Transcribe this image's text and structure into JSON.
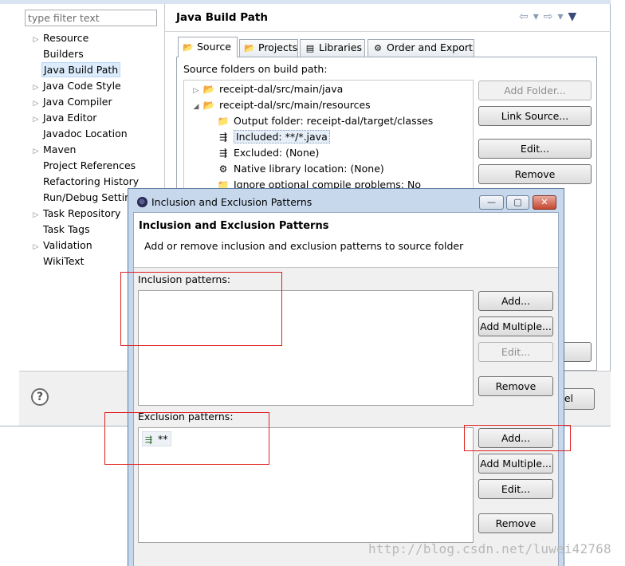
{
  "properties_window": {
    "filter": {
      "placeholder": "type filter text"
    },
    "tree": [
      {
        "label": "Resource",
        "expandable": true
      },
      {
        "label": "Builders",
        "expandable": false
      },
      {
        "label": "Java Build Path",
        "expandable": false,
        "selected": true
      },
      {
        "label": "Java Code Style",
        "expandable": true
      },
      {
        "label": "Java Compiler",
        "expandable": true
      },
      {
        "label": "Java Editor",
        "expandable": true
      },
      {
        "label": "Javadoc Location",
        "expandable": false
      },
      {
        "label": "Maven",
        "expandable": true
      },
      {
        "label": "Project References",
        "expandable": false
      },
      {
        "label": "Refactoring History",
        "expandable": false
      },
      {
        "label": "Run/Debug Setting",
        "expandable": false
      },
      {
        "label": "Task Repository",
        "expandable": true
      },
      {
        "label": "Task Tags",
        "expandable": false
      },
      {
        "label": "Validation",
        "expandable": true
      },
      {
        "label": "WikiText",
        "expandable": false
      }
    ],
    "page_title": "Java Build Path",
    "nav": {
      "back": "⇦",
      "back_menu": "▾",
      "forward": "⇨",
      "forward_menu": "▾",
      "view_menu": "▼"
    },
    "tabs": [
      {
        "label": "Source",
        "icon": "📂",
        "active": true
      },
      {
        "label": "Projects",
        "icon": "📂",
        "active": false
      },
      {
        "label": "Libraries",
        "icon": "▤",
        "active": false
      },
      {
        "label": "Order and Export",
        "icon": "⚙",
        "active": false
      }
    ],
    "source_label": "Source folders on build path:",
    "source_tree": [
      {
        "label": "receipt-dal/src/main/java",
        "twisty": "▷",
        "icon": "📂",
        "indent": 0
      },
      {
        "label": "receipt-dal/src/main/resources",
        "twisty": "◢",
        "icon": "📂",
        "indent": 0
      },
      {
        "label": "Output folder: receipt-dal/target/classes",
        "twisty": "",
        "icon": "📁",
        "indent": 1
      },
      {
        "label": "Included: **/*.java",
        "twisty": "",
        "icon": "⇶",
        "indent": 1,
        "selected": true
      },
      {
        "label": "Excluded: (None)",
        "twisty": "",
        "icon": "⇶",
        "indent": 1
      },
      {
        "label": "Native library location: (None)",
        "twisty": "",
        "icon": "⚙",
        "indent": 1
      },
      {
        "label": "Ignore optional compile problems: No",
        "twisty": "",
        "icon": "📁",
        "indent": 1
      }
    ],
    "buttons": {
      "add_folder": "Add Folder...",
      "link_source": "Link Source...",
      "edit": "Edit...",
      "remove": "Remove",
      "cancel_partial": "el"
    },
    "help": "?"
  },
  "dialog": {
    "title": "Inclusion and Exclusion Patterns",
    "win_buttons": {
      "minimize": "—",
      "maximize": "▢",
      "close": "✕"
    },
    "header_title": "Inclusion and Exclusion Patterns",
    "header_desc": "Add or remove inclusion and exclusion patterns to source folder",
    "inclusion": {
      "label": "Inclusion patterns:",
      "items": [],
      "buttons": {
        "add": "Add...",
        "add_multiple": "Add Multiple...",
        "edit": "Edit...",
        "remove": "Remove"
      }
    },
    "exclusion": {
      "label": "Exclusion patterns:",
      "items": [
        {
          "pattern": "**"
        }
      ],
      "buttons": {
        "add": "Add...",
        "add_multiple": "Add Multiple...",
        "edit": "Edit...",
        "remove": "Remove"
      }
    }
  },
  "watermark": "http://blog.csdn.net/luwei42768",
  "colors": {
    "highlight_red": "#e02020",
    "dialog_frame": "#c7d8ed",
    "selection": "#dcecfc"
  }
}
